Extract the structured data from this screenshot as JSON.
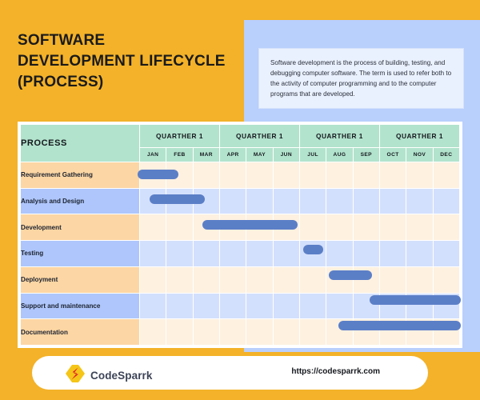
{
  "theme": {
    "bg_orange": "#f3b229",
    "panel_blue": "#b9cffc",
    "header_green": "#b2e3cd",
    "bar_blue": "#5b7fc7",
    "row_tint_orange": "#fcd6a4",
    "row_tint_blue": "#aec6fb"
  },
  "title": {
    "lines": [
      "SOFTWARE",
      "DEVELOPMENT LIFECYCLE",
      "(PROCESS)"
    ]
  },
  "description": {
    "text": "Software development is the process of building, testing, and debugging computer software. The term is used to refer both to the activity of computer programming and to the computer programs that are developed."
  },
  "table": {
    "process_header": "PROCESS",
    "quarters": [
      "QUARTHER 1",
      "QUARTHER 1",
      "QUARTHER 1",
      "QUARTHER 1"
    ],
    "months": [
      "JAN",
      "FEB",
      "MAR",
      "APR",
      "MAY",
      "JUN",
      "JUL",
      "AUG",
      "SEP",
      "OCT",
      "NOV",
      "DEC"
    ],
    "rows": [
      {
        "label": "Requirement Gathering"
      },
      {
        "label": "Analysis and Design"
      },
      {
        "label": "Development"
      },
      {
        "label": "Testing"
      },
      {
        "label": "Deployment"
      },
      {
        "label": "Support and maintenance"
      },
      {
        "label": "Documentation"
      }
    ]
  },
  "chart_data": {
    "type": "bar",
    "title": "Software Development Lifecycle (Process)",
    "xlabel": "",
    "ylabel": "Process",
    "categories": [
      "JAN",
      "FEB",
      "MAR",
      "APR",
      "MAY",
      "JUN",
      "JUL",
      "AUG",
      "SEP",
      "OCT",
      "NOV",
      "DEC"
    ],
    "xlim": [
      0,
      12
    ],
    "grid": true,
    "legend": "none",
    "tasks": [
      {
        "name": "Requirement Gathering",
        "start_month": 0.0,
        "end_month": 1.5,
        "start_label": "JAN",
        "end_label": "FEB"
      },
      {
        "name": "Analysis and Design",
        "start_month": 0.45,
        "end_month": 2.5,
        "start_label": "JAN",
        "end_label": "MAR"
      },
      {
        "name": "Development",
        "start_month": 2.4,
        "end_month": 5.95,
        "start_label": "MAR",
        "end_label": "JUN"
      },
      {
        "name": "Testing",
        "start_month": 6.15,
        "end_month": 6.9,
        "start_label": "JUL",
        "end_label": "JUL"
      },
      {
        "name": "Deployment",
        "start_month": 7.1,
        "end_month": 8.7,
        "start_label": "AUG",
        "end_label": "SEP"
      },
      {
        "name": "Support and maintenance",
        "start_month": 8.6,
        "end_month": 12.0,
        "start_label": "SEP",
        "end_label": "DEC"
      },
      {
        "name": "Documentation",
        "start_month": 7.45,
        "end_month": 12.0,
        "start_label": "AUG",
        "end_label": "DEC"
      }
    ]
  },
  "footer": {
    "brand_name": "CodeSparrk",
    "url": "https://codesparrk.com"
  }
}
